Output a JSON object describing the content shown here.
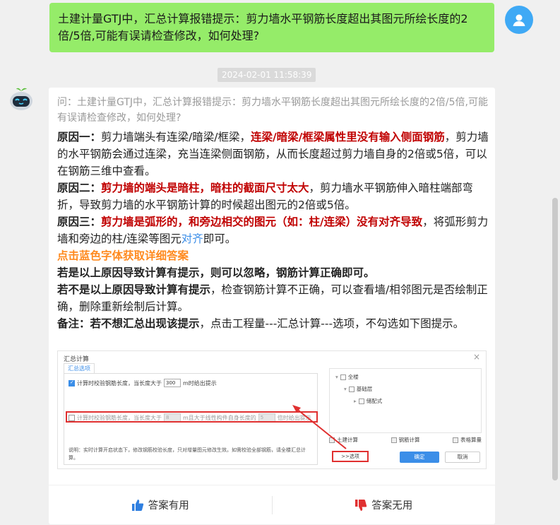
{
  "chat": {
    "user_message": "土建计量GTJ中，汇总计算报错提示：剪力墙水平钢筋长度超出其图元所绘长度的2倍/5倍,可能有误请检查修改，如何处理?",
    "timestamp": "2024-02-01 11:58:39"
  },
  "answer": {
    "question": "问：土建计量GTJ中，汇总计算报错提示：剪力墙水平钢筋长度超出其图元所绘长度的2倍/5倍,可能有误请检查修改，如何处理?",
    "r1_label": "原因一：",
    "r1_a": "剪力墙端头有连梁/暗梁/框梁，",
    "r1_red": "连梁/暗梁/框梁属性里没有输入侧面钢筋",
    "r1_b": "，剪力墙的水平钢筋会通过连梁，充当连梁侧面钢筋，从而长度超过剪力墙自身的2倍或5倍，可以在钢筋三维中查看。",
    "r2_label": "原因二：",
    "r2_red": "剪力墙的端头是暗柱，暗柱的截面尺寸太大",
    "r2_b": "，剪力墙水平钢筋伸入暗柱端部弯折，导致剪力墙的水平钢筋计算的时候超出图元的2倍或5倍。",
    "r3_label": "原因三：",
    "r3_red": "剪力墙是弧形的，和旁边相交的图元（如：柱/连梁）没有对齐导致",
    "r3_b": "，将弧形剪力墙和旁边的柱/连梁等图元",
    "r3_link": "对齐",
    "r3_c": "即可。",
    "orange_link": "点击蓝色字体获取详细答案",
    "s1": "若是以上原因导致计算有提示，则可以忽略，钢筋计算正确即可。",
    "s2_bold": "若不是以上原因导致计算有提示",
    "s2_rest": "，检查钢筋计算不正确，可以查看墙/相邻图元是否绘制正确，删除重新绘制后计算。",
    "note_label": "备注：",
    "note_bold": "若不想汇总出现该提示",
    "note_rest": "，点击工程量---汇总计算---选项，不勾选如下图提示。"
  },
  "dialog": {
    "title": "汇总计算",
    "tab": "汇总选项",
    "row1_a": "计算时校验钢筋长度，当长度大于",
    "row1_value": "300",
    "row1_b": "m时给出提示",
    "row2_a": "计算时校验钢筋长度，当长度大于",
    "row2_value1": "8",
    "row2_b": "m且大于线性构件自身长度的",
    "row2_value2": "5",
    "row2_c": "倍时给出提示",
    "note": "说明：实时计算开启状态下，修改钢筋校验长度，只对增量图元修改生效。如需校验全部钢筋，请全楼汇总计算。",
    "tree_all": "全楼",
    "tree_floor": "基础层",
    "tree_sub": "储配式",
    "cb_civil": "土建计算",
    "cb_rebar": "钢筋计算",
    "cb_table": "表格算量",
    "btn_options": ">>选项",
    "btn_ok": "确定",
    "btn_cancel": "取消"
  },
  "feedback": {
    "useful": "答案有用",
    "useless": "答案无用"
  },
  "colors": {
    "user_bubble": "#95ec69",
    "highlight_red": "#c00000",
    "link_blue": "#3b8ee8",
    "link_orange": "#ff8a1f"
  }
}
